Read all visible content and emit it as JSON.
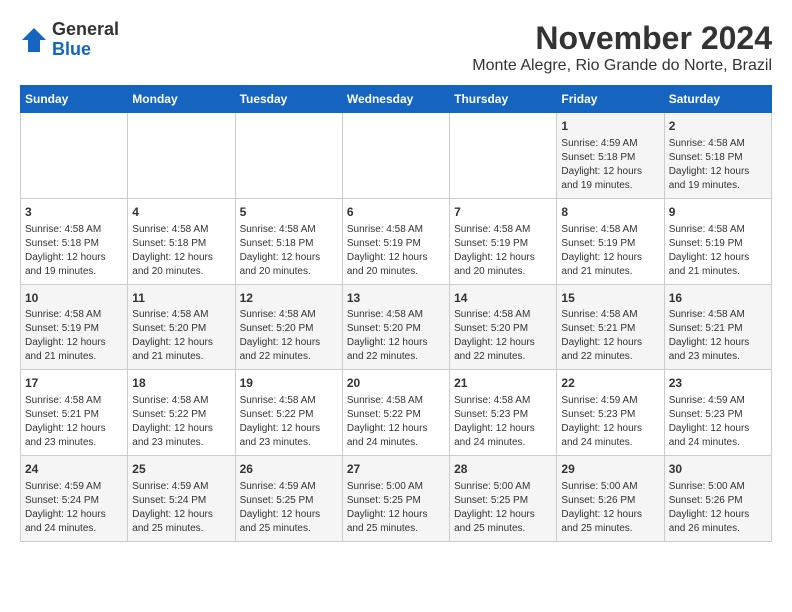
{
  "header": {
    "logo": {
      "line1": "General",
      "line2": "Blue"
    },
    "title": "November 2024",
    "location": "Monte Alegre, Rio Grande do Norte, Brazil"
  },
  "days_of_week": [
    "Sunday",
    "Monday",
    "Tuesday",
    "Wednesday",
    "Thursday",
    "Friday",
    "Saturday"
  ],
  "weeks": [
    [
      {
        "day": "",
        "info": ""
      },
      {
        "day": "",
        "info": ""
      },
      {
        "day": "",
        "info": ""
      },
      {
        "day": "",
        "info": ""
      },
      {
        "day": "",
        "info": ""
      },
      {
        "day": "1",
        "info": "Sunrise: 4:59 AM\nSunset: 5:18 PM\nDaylight: 12 hours and 19 minutes."
      },
      {
        "day": "2",
        "info": "Sunrise: 4:58 AM\nSunset: 5:18 PM\nDaylight: 12 hours and 19 minutes."
      }
    ],
    [
      {
        "day": "3",
        "info": "Sunrise: 4:58 AM\nSunset: 5:18 PM\nDaylight: 12 hours and 19 minutes."
      },
      {
        "day": "4",
        "info": "Sunrise: 4:58 AM\nSunset: 5:18 PM\nDaylight: 12 hours and 20 minutes."
      },
      {
        "day": "5",
        "info": "Sunrise: 4:58 AM\nSunset: 5:18 PM\nDaylight: 12 hours and 20 minutes."
      },
      {
        "day": "6",
        "info": "Sunrise: 4:58 AM\nSunset: 5:19 PM\nDaylight: 12 hours and 20 minutes."
      },
      {
        "day": "7",
        "info": "Sunrise: 4:58 AM\nSunset: 5:19 PM\nDaylight: 12 hours and 20 minutes."
      },
      {
        "day": "8",
        "info": "Sunrise: 4:58 AM\nSunset: 5:19 PM\nDaylight: 12 hours and 21 minutes."
      },
      {
        "day": "9",
        "info": "Sunrise: 4:58 AM\nSunset: 5:19 PM\nDaylight: 12 hours and 21 minutes."
      }
    ],
    [
      {
        "day": "10",
        "info": "Sunrise: 4:58 AM\nSunset: 5:19 PM\nDaylight: 12 hours and 21 minutes."
      },
      {
        "day": "11",
        "info": "Sunrise: 4:58 AM\nSunset: 5:20 PM\nDaylight: 12 hours and 21 minutes."
      },
      {
        "day": "12",
        "info": "Sunrise: 4:58 AM\nSunset: 5:20 PM\nDaylight: 12 hours and 22 minutes."
      },
      {
        "day": "13",
        "info": "Sunrise: 4:58 AM\nSunset: 5:20 PM\nDaylight: 12 hours and 22 minutes."
      },
      {
        "day": "14",
        "info": "Sunrise: 4:58 AM\nSunset: 5:20 PM\nDaylight: 12 hours and 22 minutes."
      },
      {
        "day": "15",
        "info": "Sunrise: 4:58 AM\nSunset: 5:21 PM\nDaylight: 12 hours and 22 minutes."
      },
      {
        "day": "16",
        "info": "Sunrise: 4:58 AM\nSunset: 5:21 PM\nDaylight: 12 hours and 23 minutes."
      }
    ],
    [
      {
        "day": "17",
        "info": "Sunrise: 4:58 AM\nSunset: 5:21 PM\nDaylight: 12 hours and 23 minutes."
      },
      {
        "day": "18",
        "info": "Sunrise: 4:58 AM\nSunset: 5:22 PM\nDaylight: 12 hours and 23 minutes."
      },
      {
        "day": "19",
        "info": "Sunrise: 4:58 AM\nSunset: 5:22 PM\nDaylight: 12 hours and 23 minutes."
      },
      {
        "day": "20",
        "info": "Sunrise: 4:58 AM\nSunset: 5:22 PM\nDaylight: 12 hours and 24 minutes."
      },
      {
        "day": "21",
        "info": "Sunrise: 4:58 AM\nSunset: 5:23 PM\nDaylight: 12 hours and 24 minutes."
      },
      {
        "day": "22",
        "info": "Sunrise: 4:59 AM\nSunset: 5:23 PM\nDaylight: 12 hours and 24 minutes."
      },
      {
        "day": "23",
        "info": "Sunrise: 4:59 AM\nSunset: 5:23 PM\nDaylight: 12 hours and 24 minutes."
      }
    ],
    [
      {
        "day": "24",
        "info": "Sunrise: 4:59 AM\nSunset: 5:24 PM\nDaylight: 12 hours and 24 minutes."
      },
      {
        "day": "25",
        "info": "Sunrise: 4:59 AM\nSunset: 5:24 PM\nDaylight: 12 hours and 25 minutes."
      },
      {
        "day": "26",
        "info": "Sunrise: 4:59 AM\nSunset: 5:25 PM\nDaylight: 12 hours and 25 minutes."
      },
      {
        "day": "27",
        "info": "Sunrise: 5:00 AM\nSunset: 5:25 PM\nDaylight: 12 hours and 25 minutes."
      },
      {
        "day": "28",
        "info": "Sunrise: 5:00 AM\nSunset: 5:25 PM\nDaylight: 12 hours and 25 minutes."
      },
      {
        "day": "29",
        "info": "Sunrise: 5:00 AM\nSunset: 5:26 PM\nDaylight: 12 hours and 25 minutes."
      },
      {
        "day": "30",
        "info": "Sunrise: 5:00 AM\nSunset: 5:26 PM\nDaylight: 12 hours and 26 minutes."
      }
    ]
  ]
}
